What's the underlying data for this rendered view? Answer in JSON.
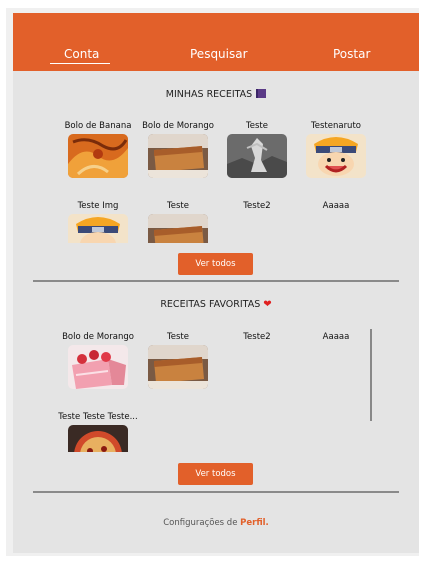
{
  "nav": {
    "tabs": [
      {
        "label": "Conta",
        "active": true
      },
      {
        "label": "Pesquisar"
      },
      {
        "label": "Postar"
      }
    ]
  },
  "my_recipes": {
    "title": "MINHAS RECEITAS",
    "title_icon": "book-icon",
    "items": [
      {
        "label": "Bolo de Banana",
        "thumb": "naruto-fox-art"
      },
      {
        "label": "Bolo de Morango",
        "thumb": "cake-slice"
      },
      {
        "label": "Teste",
        "thumb": "titan-grey"
      },
      {
        "label": "Testenaruto",
        "thumb": "naruto-face"
      },
      {
        "label": "Teste Img",
        "thumb": "naruto-face"
      },
      {
        "label": "Teste",
        "thumb": "cake-slice"
      },
      {
        "label": "Teste2",
        "thumb": null
      },
      {
        "label": "Aaaaa",
        "thumb": null
      }
    ],
    "view_all": "Ver todos"
  },
  "favorites": {
    "title": "RECEITAS FAVORITAS",
    "title_icon": "heart-icon",
    "items": [
      {
        "label": "Bolo de Morango",
        "thumb": "strawberry-cake"
      },
      {
        "label": "Teste",
        "thumb": "cake-slice"
      },
      {
        "label": "Teste2",
        "thumb": null
      },
      {
        "label": "Aaaaa",
        "thumb": null
      },
      {
        "label": "Teste Teste Teste...",
        "thumb": "pizza"
      }
    ],
    "view_all": "Ver todos"
  },
  "footer": {
    "text": "Configurações de",
    "link": "Perfil."
  },
  "colors": {
    "accent": "#e2602a",
    "background": "#e4e4e4"
  }
}
